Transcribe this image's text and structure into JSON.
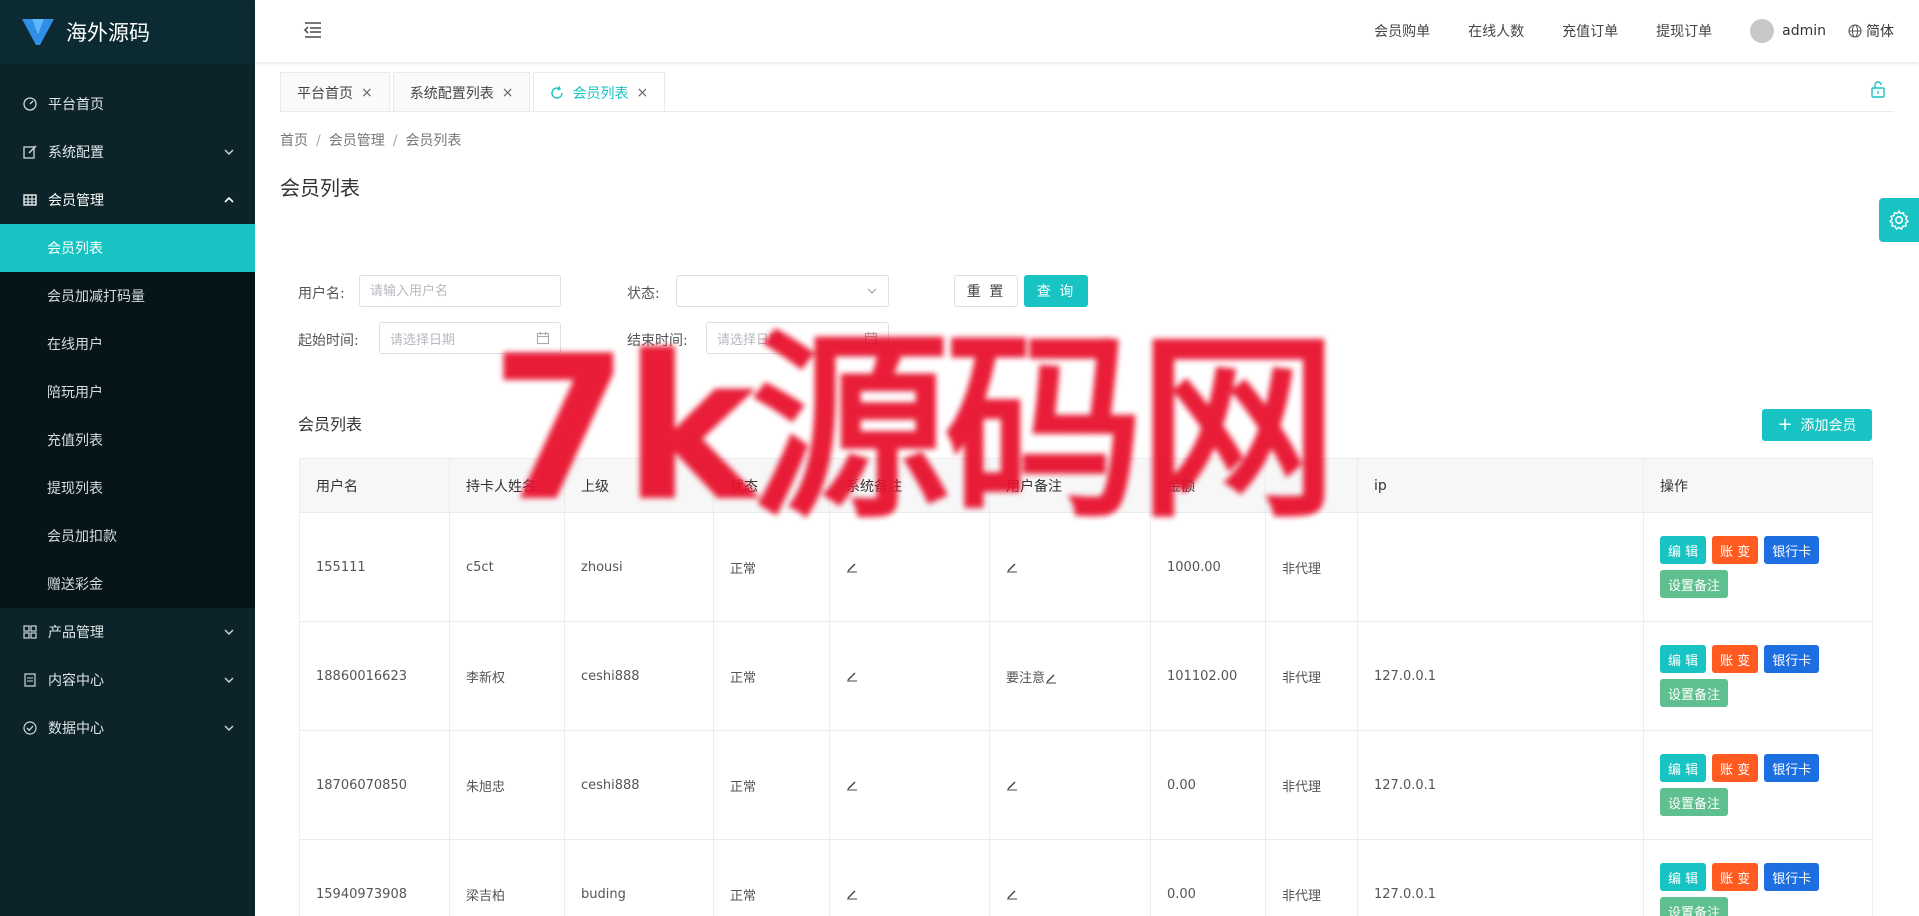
{
  "brand": {
    "title": "海外源码"
  },
  "sidebar": {
    "items": [
      {
        "label": "平台首页",
        "icon": "dashboard-icon",
        "has_children": false
      },
      {
        "label": "系统配置",
        "icon": "edit-icon",
        "has_children": true
      },
      {
        "label": "会员管理",
        "icon": "table-icon",
        "has_children": true,
        "open": true,
        "children": [
          "会员列表",
          "会员加减打码量",
          "在线用户",
          "陪玩用户",
          "充值列表",
          "提现列表",
          "会员加扣款",
          "赠送彩金"
        ],
        "active_child": "会员列表"
      },
      {
        "label": "产品管理",
        "icon": "grid-icon",
        "has_children": true
      },
      {
        "label": "内容中心",
        "icon": "document-icon",
        "has_children": true
      },
      {
        "label": "数据中心",
        "icon": "check-circle-icon",
        "has_children": true
      }
    ]
  },
  "header": {
    "links": [
      "会员购单",
      "在线人数",
      "充值订单",
      "提现订单"
    ],
    "user": "admin",
    "language": "简体"
  },
  "tabs": [
    {
      "label": "平台首页",
      "active": false
    },
    {
      "label": "系统配置列表",
      "active": false
    },
    {
      "label": "会员列表",
      "active": true
    }
  ],
  "breadcrumb": [
    "首页",
    "会员管理",
    "会员列表"
  ],
  "page_title": "会员列表",
  "filters": {
    "username_label": "用户名:",
    "username_placeholder": "请输入用户名",
    "status_label": "状态:",
    "start_label": "起始时间:",
    "start_placeholder": "请选择日期",
    "end_label": "结束时间:",
    "end_placeholder": "请选择日期",
    "reset": "重 置",
    "query": "查 询"
  },
  "list": {
    "title": "会员列表",
    "add_button": "添加会员",
    "columns": [
      "用户名",
      "持卡人姓名",
      "上级",
      "状态",
      "系统备注",
      "用户备注",
      "金额",
      "",
      "ip",
      "操作"
    ],
    "rows": [
      {
        "username": "155111",
        "cardholder": "c5ct",
        "parent": "zhousi",
        "status": "正常",
        "sys_note": "",
        "user_note": "",
        "amount": "1000.00",
        "agent": "非代理",
        "ip": ""
      },
      {
        "username": "18860016623",
        "cardholder": "李新权",
        "parent": "ceshi888",
        "status": "正常",
        "sys_note": "",
        "user_note": "要注意",
        "amount": "101102.00",
        "agent": "非代理",
        "ip": "127.0.0.1"
      },
      {
        "username": "18706070850",
        "cardholder": "朱旭忠",
        "parent": "ceshi888",
        "status": "正常",
        "sys_note": "",
        "user_note": "",
        "amount": "0.00",
        "agent": "非代理",
        "ip": "127.0.0.1"
      },
      {
        "username": "15940973908",
        "cardholder": "梁吉柏",
        "parent": "buding",
        "status": "正常",
        "sys_note": "",
        "user_note": "",
        "amount": "0.00",
        "agent": "非代理",
        "ip": "127.0.0.1"
      }
    ],
    "actions": {
      "edit": "编 辑",
      "account": "账 变",
      "bank": "银行卡",
      "note": "设置备注"
    }
  },
  "watermark": "7k源码网",
  "colors": {
    "accent": "#18c3c3",
    "sidebar_bg": "#0b2329",
    "orange": "#ff5a1f",
    "blue": "#1d6ee0",
    "green": "#5ec08e",
    "watermark": "#e8112d"
  }
}
